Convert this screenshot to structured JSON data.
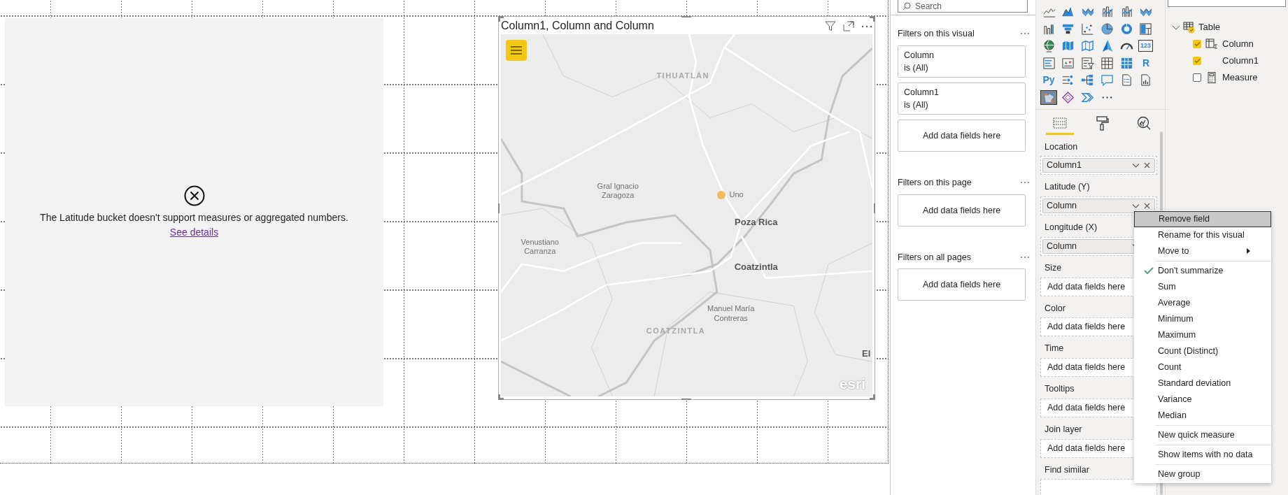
{
  "canvas": {
    "error_visual": {
      "message": "The Latitude bucket doesn't support measures or aggregated numbers.",
      "link": "See details"
    },
    "map_visual": {
      "title": "Column1, Column and Column",
      "labels": [
        {
          "text": "TIHUATLÁN",
          "kind": "district"
        },
        {
          "text": "Gral Ignacio Zaragoza",
          "kind": "town"
        },
        {
          "text": "Uno",
          "kind": "town"
        },
        {
          "text": "Poza Rica",
          "kind": "city"
        },
        {
          "text": "Venustiano Carranza",
          "kind": "town"
        },
        {
          "text": "Coatzintla",
          "kind": "city"
        },
        {
          "text": "Manuel María Contreras",
          "kind": "town"
        },
        {
          "text": "COATZINTLA",
          "kind": "district"
        },
        {
          "text": "El",
          "kind": "city"
        }
      ],
      "attribution": "esri"
    }
  },
  "filters": {
    "search": {
      "placeholder": "Search"
    },
    "sections": [
      {
        "title": "Filters on this visual",
        "cards": [
          {
            "field": "Column",
            "condition": "is (All)"
          },
          {
            "field": "Column1",
            "condition": "is (All)"
          }
        ],
        "drop_text": "Add data fields here"
      },
      {
        "title": "Filters on this page",
        "drop_text": "Add data fields here"
      },
      {
        "title": "Filters on all pages",
        "drop_text": "Add data fields here"
      }
    ]
  },
  "visualizations": {
    "gallery": [
      {
        "kind": "line",
        "selected": false
      },
      {
        "kind": "area",
        "selected": false
      },
      {
        "kind": "ribbon",
        "selected": false
      },
      {
        "kind": "combo",
        "selected": false
      },
      {
        "kind": "combo",
        "selected": false
      },
      {
        "kind": "ribbon",
        "selected": false
      },
      {
        "kind": "waterfall",
        "selected": false
      },
      {
        "kind": "funnel",
        "selected": false
      },
      {
        "kind": "scatter",
        "selected": false
      },
      {
        "kind": "pie",
        "selected": false
      },
      {
        "kind": "donut",
        "selected": false
      },
      {
        "kind": "treemap",
        "selected": false
      },
      {
        "kind": "globe",
        "selected": false
      },
      {
        "kind": "filled-map",
        "selected": false
      },
      {
        "kind": "shape-map",
        "selected": false
      },
      {
        "kind": "azure-map",
        "selected": false
      },
      {
        "kind": "gauge",
        "selected": false
      },
      {
        "kind": "card",
        "glyph": "123",
        "selected": false
      },
      {
        "kind": "multirow",
        "selected": false
      },
      {
        "kind": "kpi",
        "selected": false
      },
      {
        "kind": "slicer",
        "selected": false
      },
      {
        "kind": "table",
        "selected": false
      },
      {
        "kind": "matrix",
        "selected": false
      },
      {
        "kind": "text",
        "glyph": "R",
        "selected": false
      },
      {
        "kind": "text",
        "glyph": "Py",
        "selected": false
      },
      {
        "kind": "influencers",
        "selected": false
      },
      {
        "kind": "tree",
        "selected": false
      },
      {
        "kind": "qa",
        "selected": false
      },
      {
        "kind": "paginated",
        "selected": false
      },
      {
        "kind": "report",
        "selected": false
      },
      {
        "kind": "custom-map",
        "selected": true
      },
      {
        "kind": "diamond",
        "selected": false
      },
      {
        "kind": "chevron",
        "selected": false
      },
      {
        "kind": "more",
        "selected": false
      }
    ],
    "tabs": [
      {
        "kind": "fields",
        "selected": true
      },
      {
        "kind": "format",
        "selected": false
      },
      {
        "kind": "analytics",
        "selected": false
      }
    ],
    "wells": [
      {
        "label": "Location",
        "field": "Column1"
      },
      {
        "label": "Latitude (Y)",
        "field": "Column"
      },
      {
        "label": "Longitude (X)",
        "field": "Column"
      },
      {
        "label": "Size",
        "drop_text": "Add data fields here"
      },
      {
        "label": "Color",
        "drop_text": "Add data fields here"
      },
      {
        "label": "Time",
        "drop_text": "Add data fields here"
      },
      {
        "label": "Tooltips",
        "drop_text": "Add data fields here"
      },
      {
        "label": "Join layer",
        "drop_text": "Add data fields here"
      },
      {
        "label": "Find similar"
      }
    ]
  },
  "fields": {
    "tables": [
      {
        "name": "Table",
        "expanded": true,
        "in_use": true,
        "children": [
          {
            "name": "Column",
            "kind": "hierarchy",
            "checked": true
          },
          {
            "name": "Column1",
            "kind": "plain",
            "checked": true
          },
          {
            "name": "Measure",
            "kind": "measure",
            "checked": false
          }
        ]
      }
    ]
  },
  "context_menu": {
    "groups": [
      [
        {
          "label": "Remove field",
          "highlighted": true,
          "submenu": false
        },
        {
          "label": "Rename for this visual",
          "highlighted": false,
          "submenu": false
        },
        {
          "label": "Move to",
          "highlighted": false,
          "submenu": true
        }
      ],
      [
        {
          "label": "Don't summarize",
          "highlighted": false,
          "checked": true
        },
        {
          "label": "Sum",
          "highlighted": false,
          "checked": false
        },
        {
          "label": "Average",
          "highlighted": false,
          "checked": false
        },
        {
          "label": "Minimum",
          "highlighted": false,
          "checked": false
        },
        {
          "label": "Maximum",
          "highlighted": false,
          "checked": false
        },
        {
          "label": "Count (Distinct)",
          "highlighted": false,
          "checked": false
        },
        {
          "label": "Count",
          "highlighted": false,
          "checked": false
        },
        {
          "label": "Standard deviation",
          "highlighted": false,
          "checked": false
        },
        {
          "label": "Variance",
          "highlighted": false,
          "checked": false
        },
        {
          "label": "Median",
          "highlighted": false,
          "checked": false
        }
      ],
      [
        {
          "label": "New quick measure",
          "highlighted": false
        }
      ],
      [
        {
          "label": "Show items with no data",
          "highlighted": false
        }
      ],
      [
        {
          "label": "New group",
          "highlighted": false
        }
      ]
    ]
  }
}
